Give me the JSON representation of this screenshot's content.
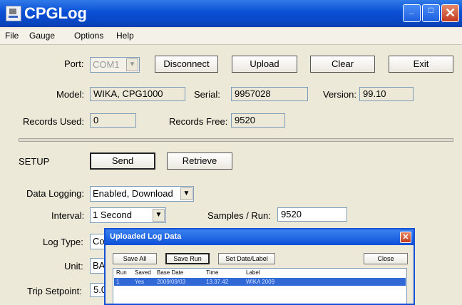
{
  "window": {
    "title": "CPGLog",
    "minimize": "_",
    "maximize": "□",
    "close": "✕"
  },
  "menu": [
    "File",
    "Gauge",
    "Options",
    "Help"
  ],
  "connection": {
    "port_label": "Port:",
    "port_value": "COM1",
    "disconnect": "Disconnect",
    "upload": "Upload",
    "clear": "Clear",
    "exit": "Exit"
  },
  "info": {
    "model_label": "Model:",
    "model_value": "WIKA, CPG1000",
    "serial_label": "Serial:",
    "serial_value": "9957028",
    "version_label": "Version:",
    "version_value": "99.10",
    "records_used_label": "Records Used:",
    "records_used_value": "0",
    "records_free_label": "Records Free:",
    "records_free_value": "9520"
  },
  "setup": {
    "title": "SETUP",
    "send": "Send",
    "retrieve": "Retrieve",
    "data_logging_label": "Data Logging:",
    "data_logging_value": "Enabled, Download",
    "interval_label": "Interval:",
    "interval_value": "1 Second",
    "samples_label": "Samples / Run:",
    "samples_value": "9520",
    "log_type_label": "Log Type:",
    "log_type_value": "Co",
    "unit_label": "Unit:",
    "unit_value": "BA",
    "trip_label": "Trip Setpoint:",
    "trip_value": "5.0"
  },
  "dialog": {
    "title": "Uploaded Log Data",
    "close_x": "✕",
    "save_all": "Save All",
    "save_run": "Save Run",
    "set_date": "Set Date/Label",
    "close": "Close",
    "columns": [
      "Run",
      "Saved",
      "Base Date",
      "Time",
      "Label"
    ],
    "rows": [
      {
        "run": "1",
        "saved": "Yes",
        "date": "2009/09/03",
        "time": "13.37.42",
        "label": "WIKA 2009"
      }
    ]
  },
  "colors": {
    "titlebar": "#0a4fd6",
    "dialog_border": "#1350d4",
    "selected_row": "#3068d6",
    "window_bg": "#ece9d8"
  }
}
